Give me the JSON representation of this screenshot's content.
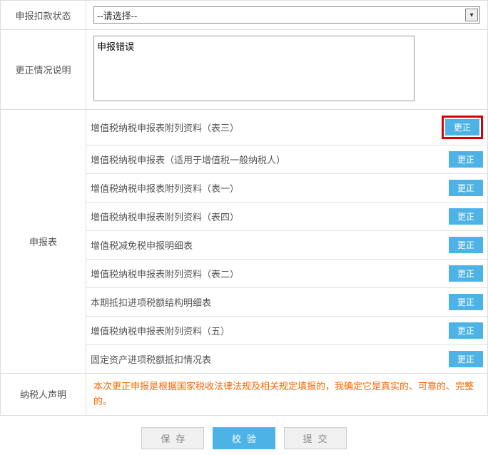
{
  "status": {
    "label": "申报扣款状态",
    "placeholder": "--请选择--"
  },
  "desc": {
    "label": "更正情况说明",
    "value": "申报错误"
  },
  "forms": {
    "label": "申报表",
    "items": [
      {
        "name": "增值税纳税申报表附列资料（表三）",
        "btn": "更正",
        "hl": true
      },
      {
        "name": "增值税纳税申报表（适用于增值税一般纳税人）",
        "btn": "更正",
        "hl": false
      },
      {
        "name": "增值税纳税申报表附列资料（表一）",
        "btn": "更正",
        "hl": false
      },
      {
        "name": "增值税纳税申报表附列资料（表四）",
        "btn": "更正",
        "hl": false
      },
      {
        "name": "增值税减免税申报明细表",
        "btn": "更正",
        "hl": false
      },
      {
        "name": "增值税纳税申报表附列资料（表二）",
        "btn": "更正",
        "hl": false
      },
      {
        "name": "本期抵扣进项税额结构明细表",
        "btn": "更正",
        "hl": false
      },
      {
        "name": "增值税纳税申报表附列资料（五）",
        "btn": "更正",
        "hl": false
      },
      {
        "name": "固定资产进项税额抵扣情况表",
        "btn": "更正",
        "hl": false
      }
    ]
  },
  "decl": {
    "label": "纳税人声明",
    "text": "本次更正申报是根据国家税收法律法规及相关规定填报的，我确定它是真实的、可靠的、完整的。"
  },
  "footer": {
    "save": "保存",
    "validate": "校验",
    "submit": "提交"
  }
}
